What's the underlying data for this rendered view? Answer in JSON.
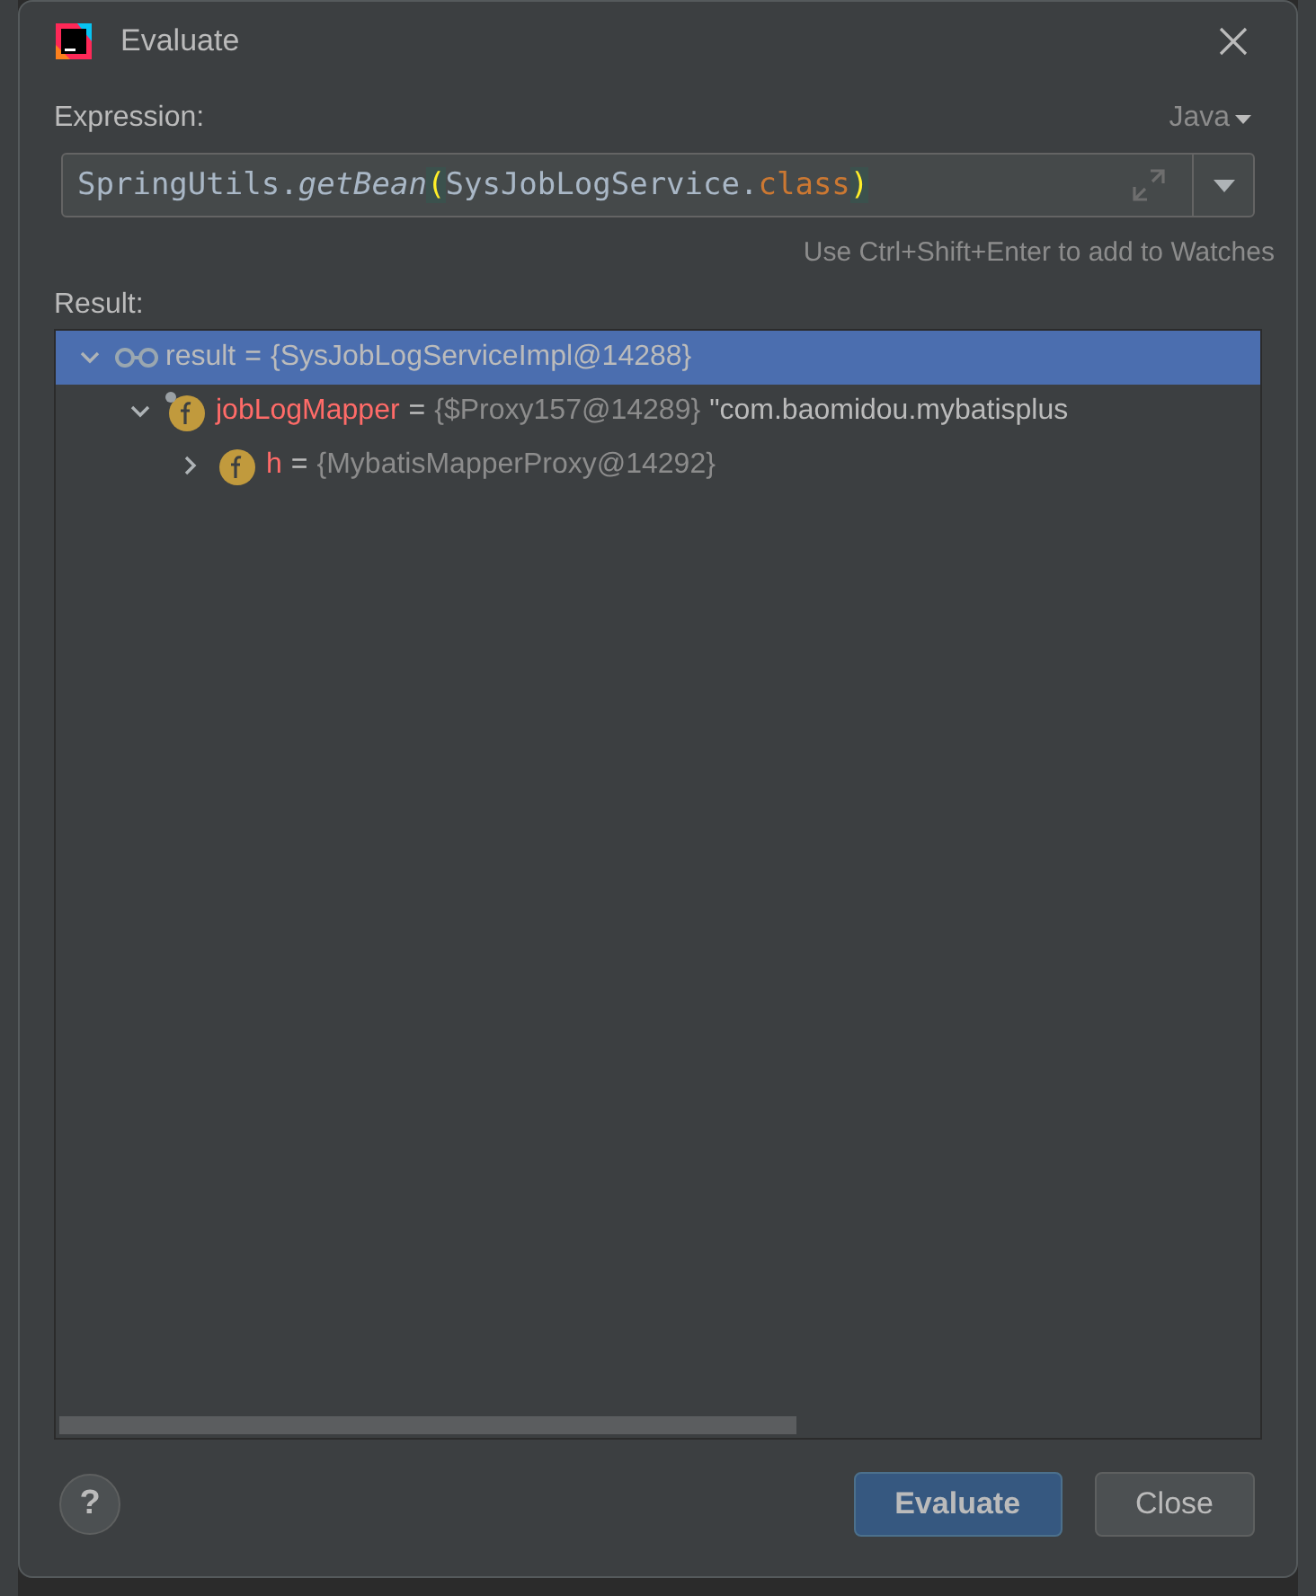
{
  "window": {
    "title": "Evaluate"
  },
  "expression": {
    "label": "Expression:",
    "language": "Java",
    "tokens": [
      {
        "text": "SpringUtils.",
        "kind": "plain"
      },
      {
        "text": "getBean",
        "kind": "italic"
      },
      {
        "text": "(",
        "kind": "brace"
      },
      {
        "text": "SysJobLogService.",
        "kind": "plain"
      },
      {
        "text": "class",
        "kind": "keyword"
      },
      {
        "text": ")",
        "kind": "brace"
      }
    ],
    "hint": "Use Ctrl+Shift+Enter to add to Watches"
  },
  "result": {
    "label": "Result:",
    "tree": [
      {
        "kind": "watch",
        "name": "result",
        "separator": "=",
        "value": "{SysJobLogServiceImpl@14288}",
        "selected": true,
        "expanded": true,
        "children": [
          {
            "kind": "field",
            "name": "jobLogMapper",
            "separator": "=",
            "value": "{$Proxy157@14289}",
            "detail": "\"com.baomidou.mybatisplus",
            "selected": false,
            "expanded": true,
            "children": [
              {
                "kind": "field",
                "name": "h",
                "separator": "=",
                "value": "{MybatisMapperProxy@14292}",
                "selected": false,
                "expanded": false
              }
            ]
          }
        ]
      }
    ]
  },
  "buttons": [
    {
      "label": "Evaluate",
      "kind": "primary"
    },
    {
      "label": "Close",
      "kind": "secondary"
    }
  ],
  "help": "?"
}
